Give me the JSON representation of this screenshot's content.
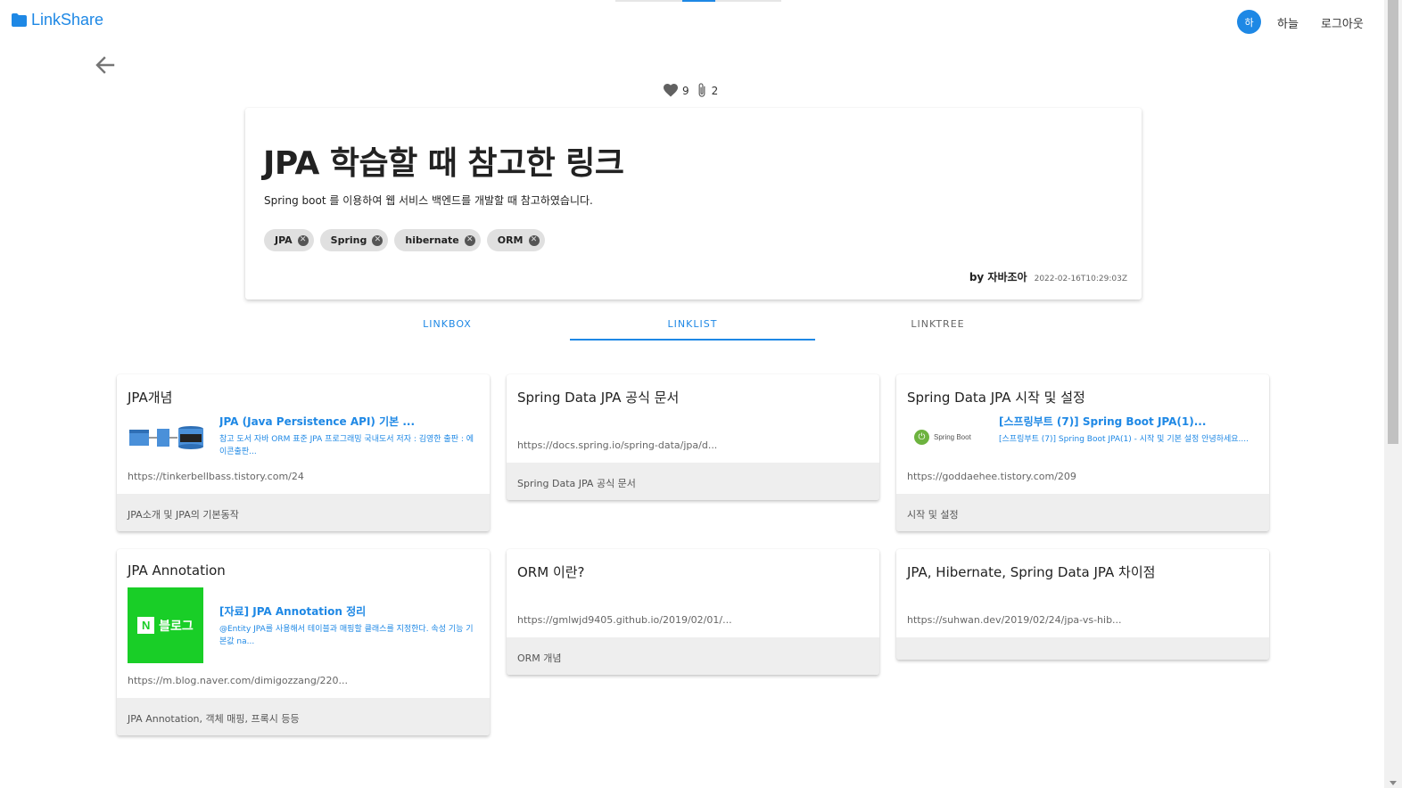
{
  "header": {
    "brand": "LinkShare",
    "avatar_initial": "하",
    "user_name": "하늘",
    "logout_label": "로그아웃"
  },
  "stats": {
    "likes": "9",
    "clips": "2"
  },
  "post": {
    "title": "JPA 학습할 때 참고한 링크",
    "description": "Spring boot 를 이용하여 웹 서비스 백엔드를 개발할 때 참고하였습니다.",
    "tags": [
      "JPA",
      "Spring",
      "hibernate",
      "ORM"
    ],
    "author": "by 자바조아",
    "date": "2022-02-16T10:29:03Z"
  },
  "tabs": [
    "LINKBOX",
    "LINKLIST",
    "LINKTREE"
  ],
  "active_tab": "LINKLIST",
  "links": [
    {
      "title": "JPA개념",
      "preview_title": "JPA (Java Persistence API) 기본 ...",
      "preview_desc": "참고 도서 자바 ORM 표준 JPA 프로그래밍 국내도서 저자 : 김영한 출판 : 에이콘출판...",
      "url": "https://tinkerbellbass.tistory.com/24",
      "memo": "JPA소개 및 JPA의 기본동작"
    },
    {
      "title": "Spring Data JPA 공식 문서",
      "url": "https://docs.spring.io/spring-data/jpa/d...",
      "memo": "Spring Data JPA 공식 문서"
    },
    {
      "title": "Spring Data JPA 시작 및 설정",
      "preview_title": "[스프링부트 (7)] Spring Boot JPA(1)...",
      "preview_desc": "[스프링부트 (7)] Spring Boot JPA(1) - 시작 및 기본 설정 안녕하세요....",
      "thumb_label": "Spring Boot",
      "url": "https://goddaehee.tistory.com/209",
      "memo": "시작 및 설정"
    },
    {
      "title": "JPA Annotation",
      "preview_title": "[자료] JPA Annotation 정리",
      "preview_desc": "@Entity JPA를 사용해서 테이블과 매핑할 클래스를 지정한다. 속성 기능 기본값 na...",
      "thumb_label": "블로그",
      "thumb_letter": "N",
      "url": "https://m.blog.naver.com/dimigozzang/220...",
      "memo": "JPA Annotation, 객체 매핑, 프록시 등등"
    },
    {
      "title": "ORM 이란?",
      "url": "https://gmlwjd9405.github.io/2019/02/01/...",
      "memo": "ORM 개념"
    },
    {
      "title": "JPA, Hibernate, Spring Data JPA 차이점",
      "url": "https://suhwan.dev/2019/02/24/jpa-vs-hib...",
      "memo": ""
    }
  ],
  "colors": {
    "accent": "#1e88e5",
    "footer_bg": "#eeeeee",
    "naver_green": "#19ce27",
    "spring_green": "#6db33f"
  }
}
